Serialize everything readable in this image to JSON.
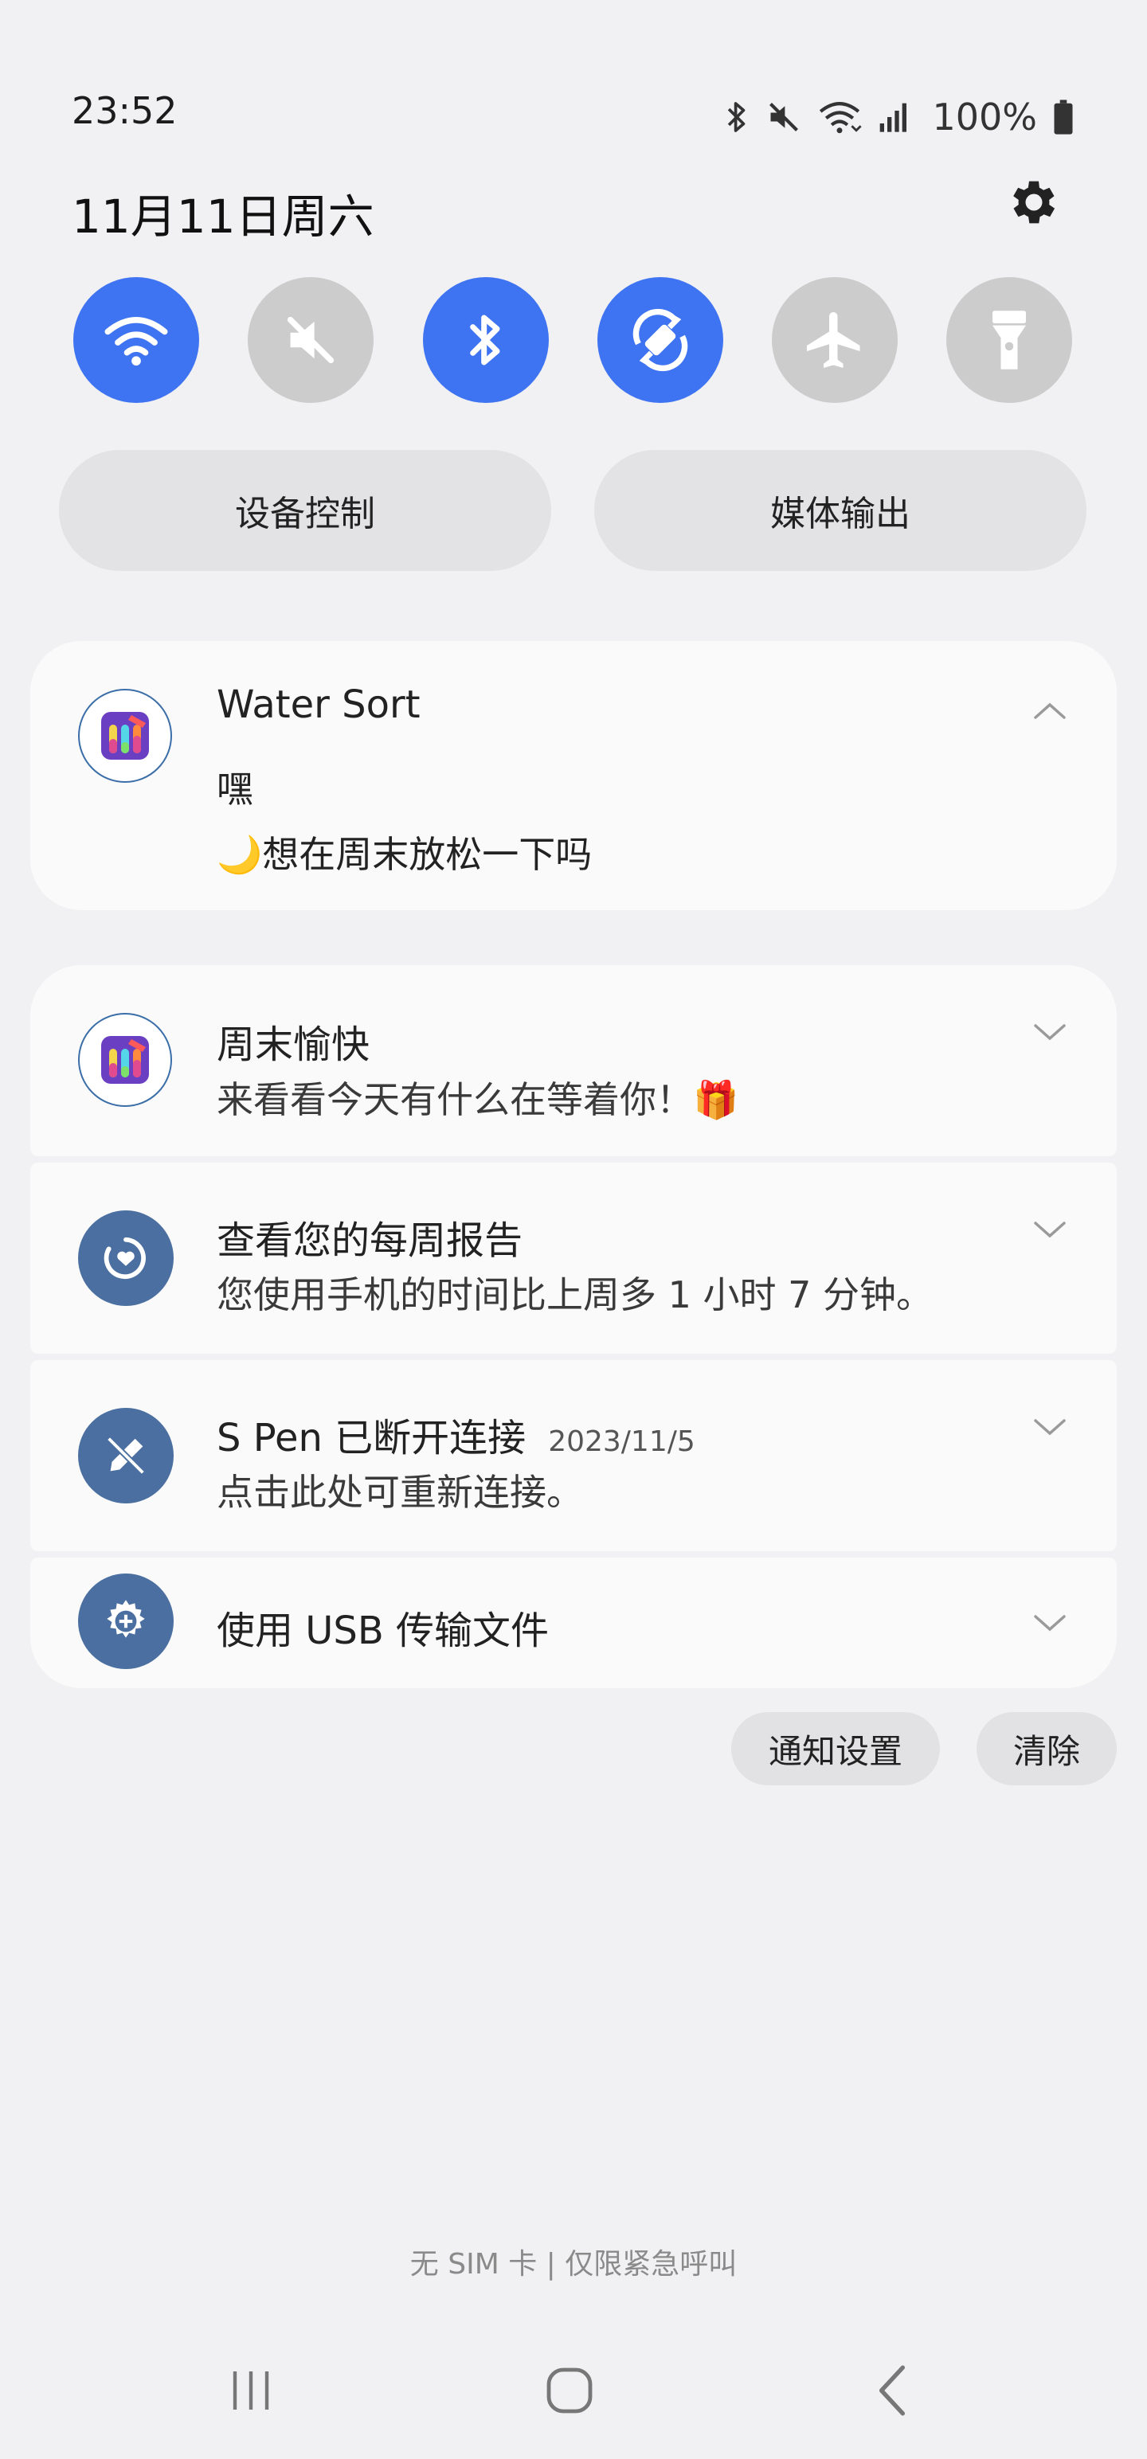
{
  "status_bar": {
    "time": "23:52",
    "battery": "100%",
    "icons": [
      "bluetooth-icon",
      "mute-icon",
      "wifi-icon",
      "signal-icon",
      "battery-icon"
    ]
  },
  "panel": {
    "date": "11月11日周六",
    "settings_icon": "gear-icon"
  },
  "quick_toggles": [
    {
      "name": "wifi",
      "icon": "wifi-icon",
      "state": "on"
    },
    {
      "name": "sound",
      "icon": "mute-icon",
      "state": "off"
    },
    {
      "name": "bluetooth",
      "icon": "bluetooth-icon",
      "state": "on"
    },
    {
      "name": "auto-rotate",
      "icon": "rotate-icon",
      "state": "on"
    },
    {
      "name": "airplane",
      "icon": "airplane-icon",
      "state": "off"
    },
    {
      "name": "flashlight",
      "icon": "flashlight-icon",
      "state": "off"
    }
  ],
  "buttons": {
    "device_control": "设备控制",
    "media_output": "媒体输出",
    "notification_settings": "通知设置",
    "clear": "清除"
  },
  "notifications": [
    {
      "app": "Water Sort",
      "line1": "嘿",
      "line2": "🌙想在周末放松一下吗",
      "expanded": true
    },
    {
      "title": "周末愉快",
      "body": "来看看今天有什么在等着你！🎁",
      "expanded": false
    },
    {
      "title": "查看您的每周报告",
      "body": "您使用手机的时间比上周多 1 小时 7 分钟。",
      "expanded": false
    },
    {
      "title": "S Pen 已断开连接",
      "time": "2023/11/5",
      "body": "点击此处可重新连接。",
      "expanded": false
    },
    {
      "title": "使用 USB 传输文件",
      "expanded": false
    }
  ],
  "footer": "无 SIM 卡 | 仅限紧急呼叫",
  "colors": {
    "accent": "#3e73f2",
    "toggle_off": "#cccccc",
    "system_icon_bg": "#4a6fa0",
    "background": "#f1f1f3"
  }
}
